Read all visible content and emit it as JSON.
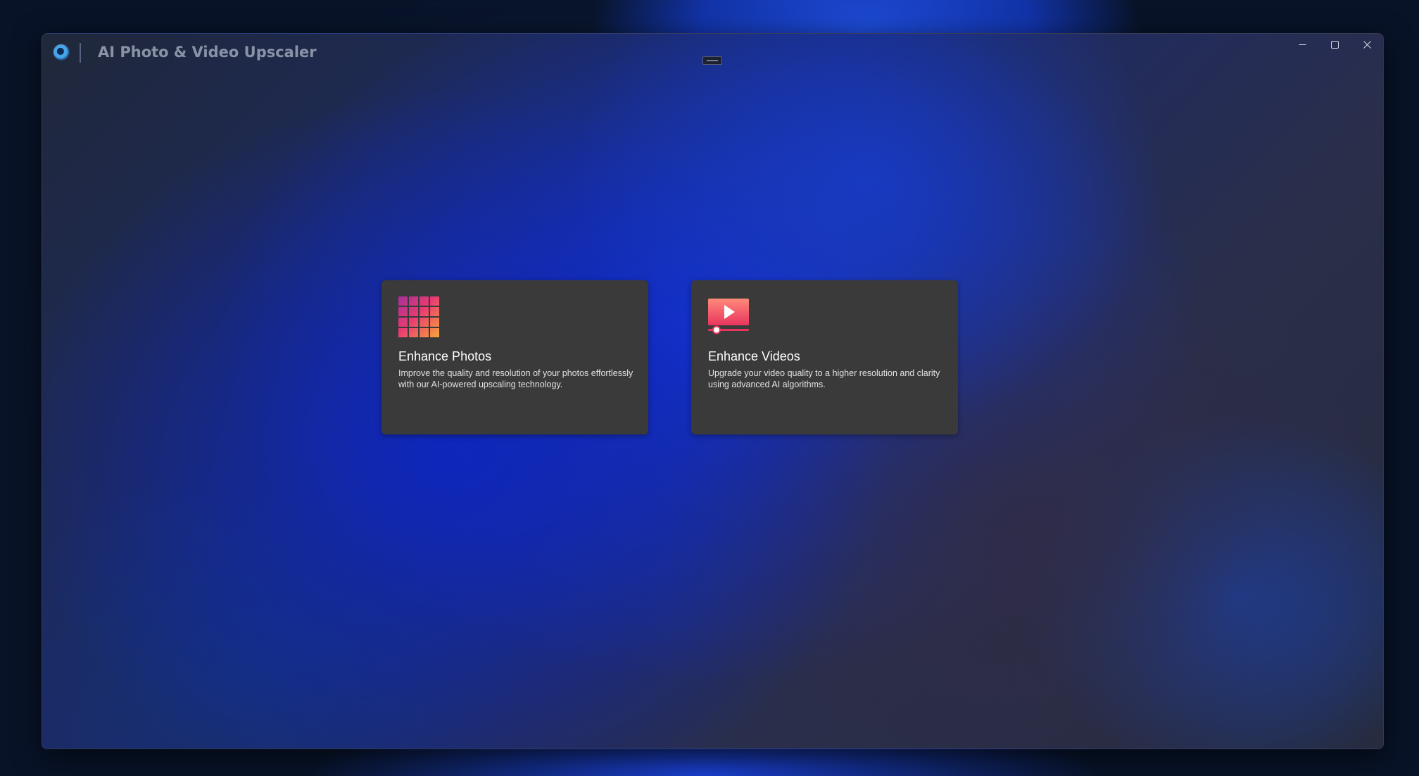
{
  "window": {
    "title": "AI Photo & Video Upscaler",
    "logo_icon": "app-logo-icon",
    "controls": {
      "minimize_icon": "minimize-icon",
      "maximize_icon": "maximize-icon",
      "close_icon": "close-icon"
    }
  },
  "cards": [
    {
      "id": "photos",
      "icon": "photo-grid-icon",
      "title": "Enhance Photos",
      "description": "Improve the quality and resolution of your photos effortlessly with our AI-powered upscaling technology."
    },
    {
      "id": "videos",
      "icon": "video-player-icon",
      "title": "Enhance Videos",
      "description": "Upgrade your video quality to a higher resolution and clarity using advanced AI algorithms."
    }
  ],
  "colors": {
    "card_background": "#3a3a3a",
    "icon_gradient_start": "#c8308c",
    "icon_gradient_end": "#f7a53b",
    "title_text": "#8a93a6"
  }
}
